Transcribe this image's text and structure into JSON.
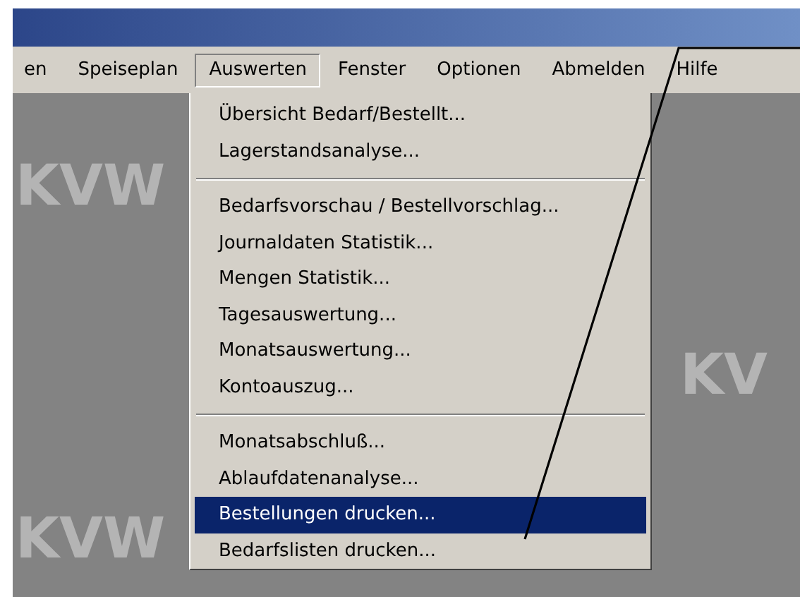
{
  "menu_bar": [
    {
      "label": "en",
      "selected": false
    },
    {
      "label": "Speiseplan",
      "selected": false
    },
    {
      "label": "Auswerten",
      "selected": true
    },
    {
      "label": "Fenster",
      "selected": false
    },
    {
      "label": "Optionen",
      "selected": false
    },
    {
      "label": "Abmelden",
      "selected": false
    },
    {
      "label": "Hilfe",
      "selected": false
    }
  ],
  "dropdown": {
    "items": [
      {
        "kind": "item",
        "label": "Übersicht Bedarf/Bestellt...",
        "selected": false
      },
      {
        "kind": "item",
        "label": "Lagerstandsanalyse...",
        "selected": false
      },
      {
        "kind": "separator"
      },
      {
        "kind": "item",
        "label": "Bedarfsvorschau / Bestellvorschlag...",
        "selected": false
      },
      {
        "kind": "item",
        "label": "Journaldaten Statistik...",
        "selected": false
      },
      {
        "kind": "item",
        "label": "Mengen Statistik...",
        "selected": false
      },
      {
        "kind": "item",
        "label": "Tagesauswertung...",
        "selected": false
      },
      {
        "kind": "item",
        "label": "Monatsauswertung...",
        "selected": false
      },
      {
        "kind": "item",
        "label": "Kontoauszug...",
        "selected": false
      },
      {
        "kind": "separator"
      },
      {
        "kind": "item",
        "label": "Monatsabschluß...",
        "selected": false
      },
      {
        "kind": "item",
        "label": "Ablaufdatenanalyse...",
        "selected": false
      },
      {
        "kind": "item",
        "label": "Bestellungen drucken...",
        "selected": true
      },
      {
        "kind": "item",
        "label": "Bedarfslisten drucken...",
        "selected": false
      }
    ]
  },
  "background_logos": [
    "KVW",
    "KV",
    "KVW"
  ]
}
